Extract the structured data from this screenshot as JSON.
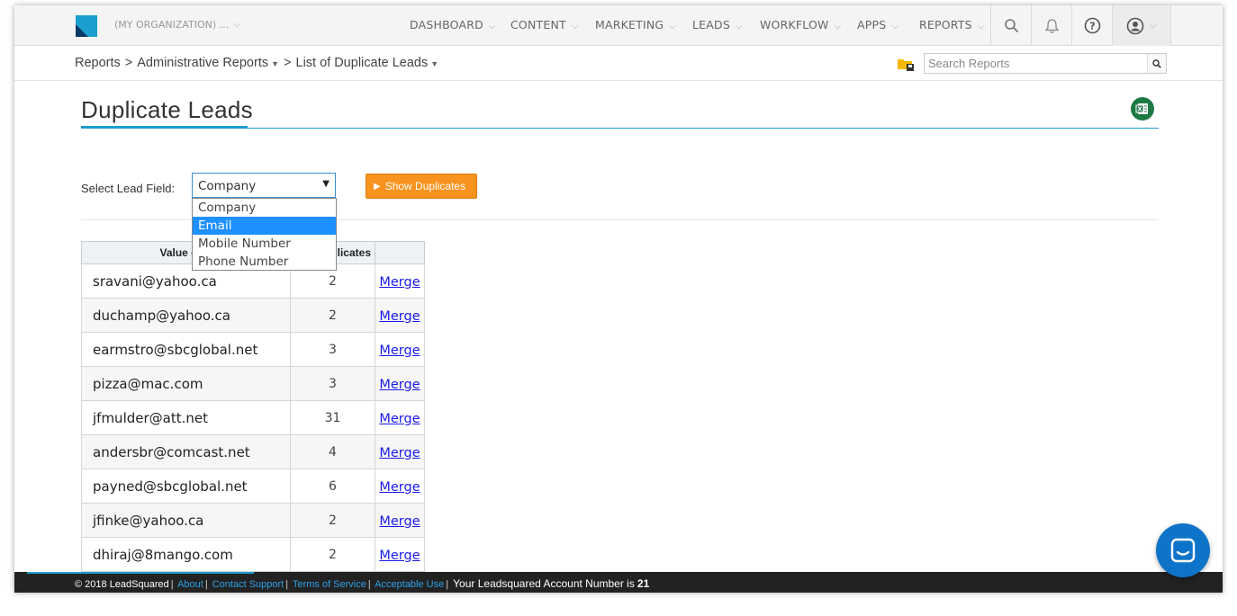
{
  "org": {
    "name": "(MY ORGANIZATION) ..."
  },
  "nav": {
    "items": [
      {
        "label": "DASHBOARD"
      },
      {
        "label": "CONTENT"
      },
      {
        "label": "MARKETING"
      },
      {
        "label": "LEADS"
      },
      {
        "label": "WORKFLOW"
      },
      {
        "label": "APPS"
      },
      {
        "label": "REPORTS"
      }
    ]
  },
  "breadcrumb": {
    "root": "Reports",
    "section": "Administrative Reports",
    "current": "List of Duplicate Leads",
    "separator": ">"
  },
  "search": {
    "placeholder": "Search Reports"
  },
  "page": {
    "title": "Duplicate Leads"
  },
  "filter": {
    "label": "Select Lead Field:",
    "selected": "Company",
    "options": [
      "Company",
      "Email",
      "Mobile Number",
      "Phone Number"
    ],
    "highlighted": "Email",
    "button_label": "Show Duplicates"
  },
  "table": {
    "headers": {
      "col1": "Value of C",
      "col2": "plicates",
      "col3": ""
    },
    "action_label": "Merge",
    "rows": [
      {
        "value": "sravani@yahoo.ca",
        "count": "2"
      },
      {
        "value": "duchamp@yahoo.ca",
        "count": "2"
      },
      {
        "value": "earmstro@sbcglobal.net",
        "count": "3"
      },
      {
        "value": "pizza@mac.com",
        "count": "3"
      },
      {
        "value": "jfmulder@att.net",
        "count": "31"
      },
      {
        "value": "andersbr@comcast.net",
        "count": "4"
      },
      {
        "value": "payned@sbcglobal.net",
        "count": "6"
      },
      {
        "value": "jfinke@yahoo.ca",
        "count": "2"
      },
      {
        "value": "dhiraj@8mango.com",
        "count": "2"
      }
    ]
  },
  "footer": {
    "copyright": "© 2018 LeadSquared",
    "links": [
      "About",
      "Contact Support",
      "Terms of Service",
      "Acceptable Use"
    ],
    "account_text": "Your Leadsquared Account Number is",
    "account_number": "21"
  },
  "colors": {
    "accent": "#1a9fd0",
    "button_orange": "#f7931e",
    "selection_blue": "#1e90ff",
    "chat_blue": "#0e74c9",
    "footer_bg": "#222222"
  }
}
